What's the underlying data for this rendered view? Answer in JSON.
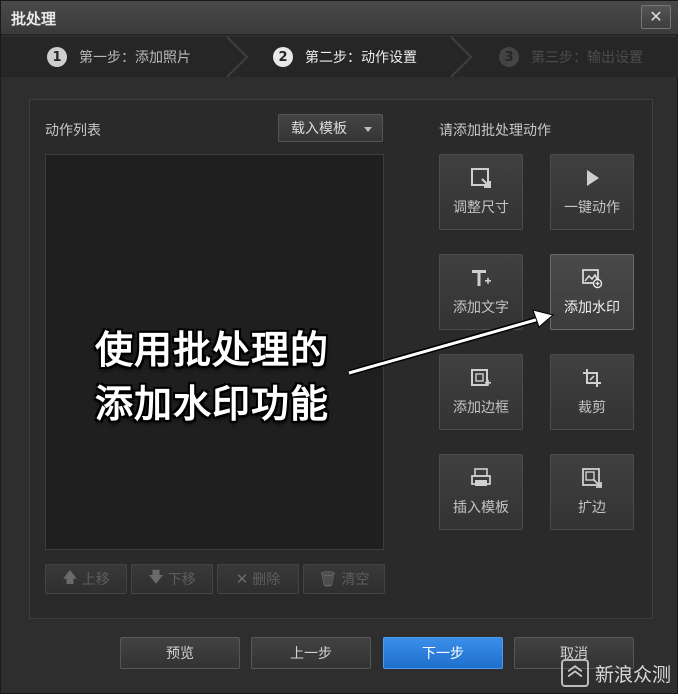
{
  "window": {
    "title": "批处理",
    "close_glyph": "✕"
  },
  "steps": [
    {
      "num": "1",
      "label": "第一步：添加照片"
    },
    {
      "num": "2",
      "label": "第二步：动作设置"
    },
    {
      "num": "3",
      "label": "第三步：输出设置"
    }
  ],
  "action_list": {
    "label": "动作列表",
    "template_button": "载入模板",
    "buttons": [
      {
        "icon": "arrow-up-icon",
        "glyph": "🡅",
        "label": "上移"
      },
      {
        "icon": "arrow-down-icon",
        "glyph": "🡇",
        "label": "下移"
      },
      {
        "icon": "close-icon",
        "glyph": "✕",
        "label": "删除"
      },
      {
        "icon": "trash-icon",
        "glyph": "🗑",
        "label": "清空"
      }
    ]
  },
  "actions": {
    "label": "请添加批处理动作",
    "tiles": [
      {
        "icon": "resize-icon",
        "label": "调整尺寸"
      },
      {
        "icon": "play-icon",
        "label": "一键动作"
      },
      {
        "icon": "text-icon",
        "label": "添加文字"
      },
      {
        "icon": "watermark-icon",
        "label": "添加水印"
      },
      {
        "icon": "frame-icon",
        "label": "添加边框"
      },
      {
        "icon": "crop-icon",
        "label": "裁剪"
      },
      {
        "icon": "template-icon",
        "label": "插入模板"
      },
      {
        "icon": "expand-icon",
        "label": "扩边"
      }
    ]
  },
  "overlay": {
    "line1": "使用批处理的",
    "line2": "添加水印功能"
  },
  "footer": {
    "preview": "预览",
    "prev": "上一步",
    "next": "下一步",
    "cancel": "取消"
  },
  "watermark": {
    "text": "新浪众测"
  },
  "colors": {
    "primary": "#2a7ddc",
    "background": "#2e2e2e"
  }
}
